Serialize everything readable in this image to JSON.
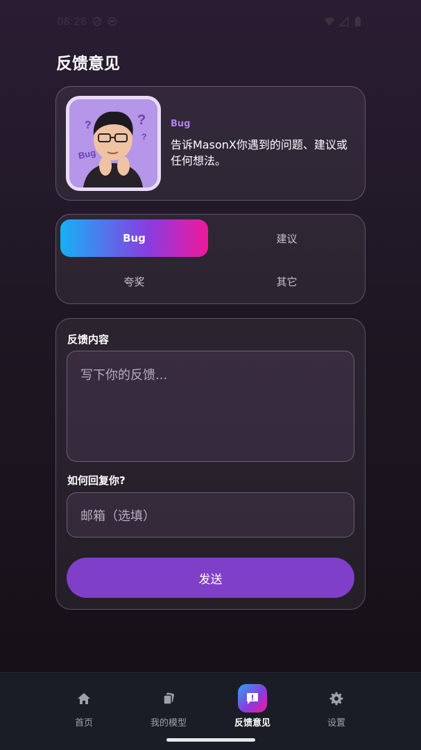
{
  "status_bar": {
    "time": "08:28",
    "icons": [
      "shield-icon",
      "face-icon",
      "wifi-icon",
      "signal-icon",
      "battery-icon"
    ]
  },
  "page": {
    "title": "反馈意见"
  },
  "intro": {
    "tag": "Bug",
    "description": "告诉MasonX你遇到的问题、建议或任何想法。",
    "avatar_icon": "avatar-illustration"
  },
  "feedback_types": [
    {
      "label": "Bug",
      "selected": true
    },
    {
      "label": "建议",
      "selected": false
    },
    {
      "label": "夸奖",
      "selected": false
    },
    {
      "label": "其它",
      "selected": false
    }
  ],
  "form": {
    "content_label": "反馈内容",
    "content_placeholder": "写下你的反馈...",
    "reply_label": "如何回复你?",
    "email_placeholder": "邮箱（选填）",
    "send_label": "发送"
  },
  "bottom_nav": [
    {
      "label": "首页",
      "icon": "home-icon",
      "active": false
    },
    {
      "label": "我的模型",
      "icon": "models-icon",
      "active": false
    },
    {
      "label": "反馈意见",
      "icon": "feedback-icon",
      "active": true
    },
    {
      "label": "设置",
      "icon": "gear-icon",
      "active": false
    }
  ],
  "colors": {
    "accent": "#7f3fc8",
    "tag": "#b47fe8",
    "gradient_start": "#17b0f5",
    "gradient_end": "#f0189a"
  }
}
